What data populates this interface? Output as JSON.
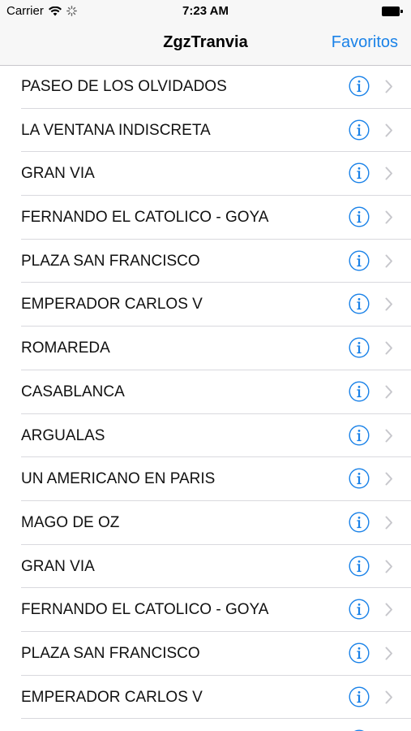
{
  "status": {
    "carrier": "Carrier",
    "time": "7:23 AM"
  },
  "nav": {
    "title": "ZgzTranvia",
    "right_button": "Favoritos",
    "accent": "#1a82e8"
  },
  "stops": [
    {
      "name": "PASEO DE LOS OLVIDADOS"
    },
    {
      "name": "LA VENTANA INDISCRETA"
    },
    {
      "name": "GRAN VIA"
    },
    {
      "name": "FERNANDO EL CATOLICO - GOYA"
    },
    {
      "name": "PLAZA SAN FRANCISCO"
    },
    {
      "name": "EMPERADOR CARLOS V"
    },
    {
      "name": "ROMAREDA"
    },
    {
      "name": "CASABLANCA"
    },
    {
      "name": "ARGUALAS"
    },
    {
      "name": "UN AMERICANO EN PARIS"
    },
    {
      "name": "MAGO DE OZ"
    },
    {
      "name": "GRAN VIA"
    },
    {
      "name": "FERNANDO EL CATOLICO - GOYA"
    },
    {
      "name": "PLAZA SAN FRANCISCO"
    },
    {
      "name": "EMPERADOR CARLOS V"
    },
    {
      "name": ""
    }
  ],
  "icons": {
    "row_info": "info-icon",
    "row_disclosure": "chevron-right-icon"
  }
}
